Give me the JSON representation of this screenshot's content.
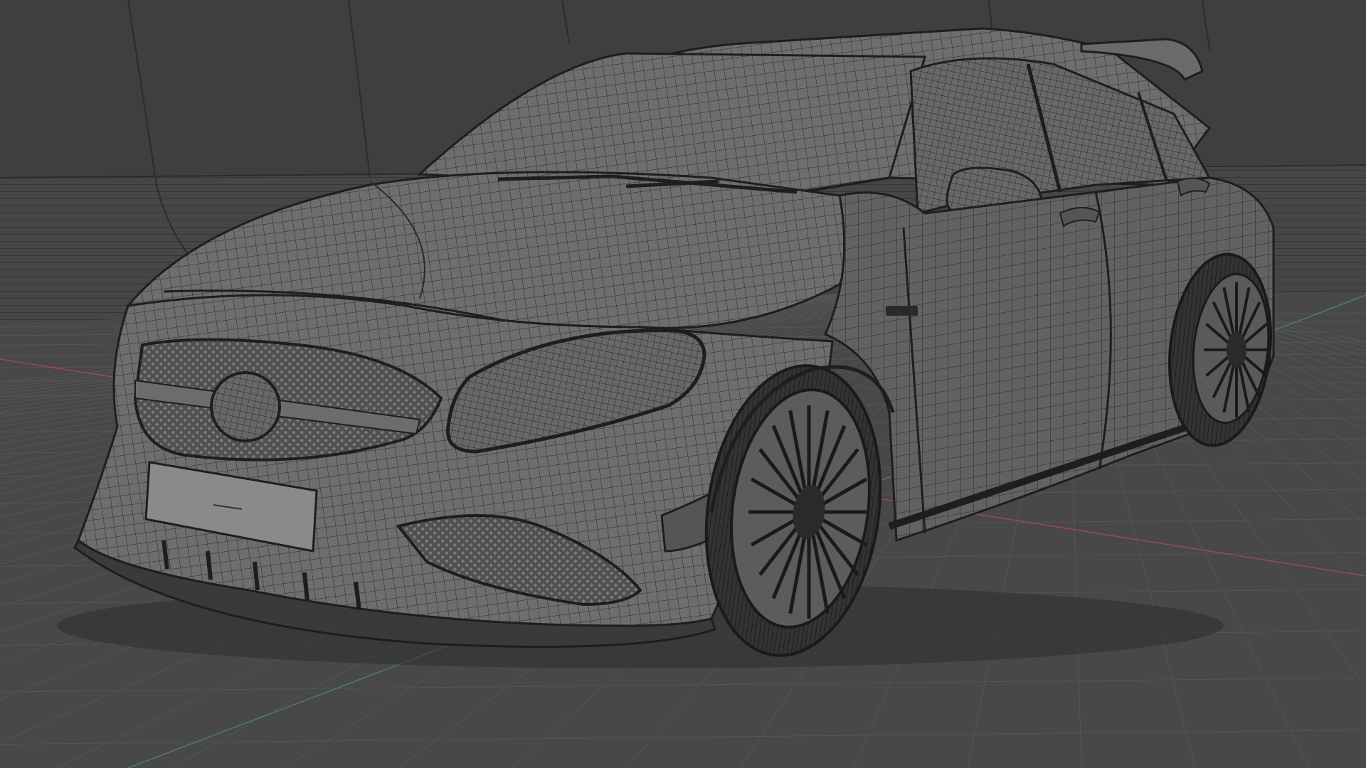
{
  "viewport": {
    "mode": "3d-viewport-wireframe-overlay",
    "background_color": "#3d3d3d",
    "grid_floor_color": "#4a4a4a",
    "grid_line_color": "#555555",
    "backdrop_color": "#474747",
    "x_axis_color": "#b34a4a",
    "y_axis_color": "#4f8f58",
    "wire_color": "#1e1e1e",
    "mesh_fill_color": "#6e6e6e",
    "tire_color": "#2a2a2a"
  },
  "model": {
    "subject": "hatchback-car",
    "icon_name": "car-mesh-icon",
    "badge_text": "",
    "plate_text": ""
  }
}
